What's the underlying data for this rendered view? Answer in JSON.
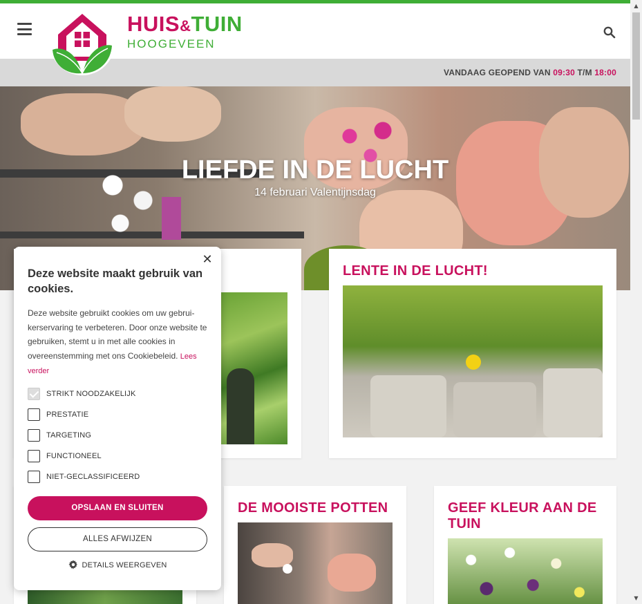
{
  "brand": {
    "name_part1": "HUIS",
    "ampersand": "&",
    "name_part2": "TUIN",
    "location": "HOOGEVEEN"
  },
  "header": {
    "menu_icon": "hamburger-icon",
    "search_icon": "search-icon",
    "opening_prefix": "VANDAAG GEOPEND VAN ",
    "opening_from": "09:30",
    "opening_sep": " T/M ",
    "opening_to": "18:00"
  },
  "hero": {
    "title": "LIEFDE IN DE LUCHT",
    "subtitle": "14 februari Valentijnsdag"
  },
  "cards": [
    {
      "title": "LENTE IN DE LUCHT!"
    },
    {
      "title": "DE MOOISTE POTTEN"
    },
    {
      "title": "GEEF KLEUR AAN DE TUIN"
    }
  ],
  "cookie": {
    "title": "Deze website maakt gebruik van cookies.",
    "body": "Deze website gebruikt cookies om uw gebrui­kerservaring te verbeteren. Door onze website te gebruiken, stemt u in met alle cookies in overeenstemming met ons Cookiebeleid.",
    "read_more": "Lees verder",
    "options": [
      {
        "label": "STRIKT NOODZAKELIJK",
        "checked": true
      },
      {
        "label": "PRESTATIE",
        "checked": false
      },
      {
        "label": "TARGETING",
        "checked": false
      },
      {
        "label": "FUNCTIONEEL",
        "checked": false
      },
      {
        "label": "NIET-GECLASSIFICEERD",
        "checked": false
      }
    ],
    "save_button": "OPSLAAN EN SLUITEN",
    "reject_button": "ALLES AFWIJZEN",
    "details_button": "DETAILS WEERGEVEN",
    "close_symbol": "✕"
  },
  "colors": {
    "brand_magenta": "#c8115d",
    "brand_green": "#3fae36"
  }
}
